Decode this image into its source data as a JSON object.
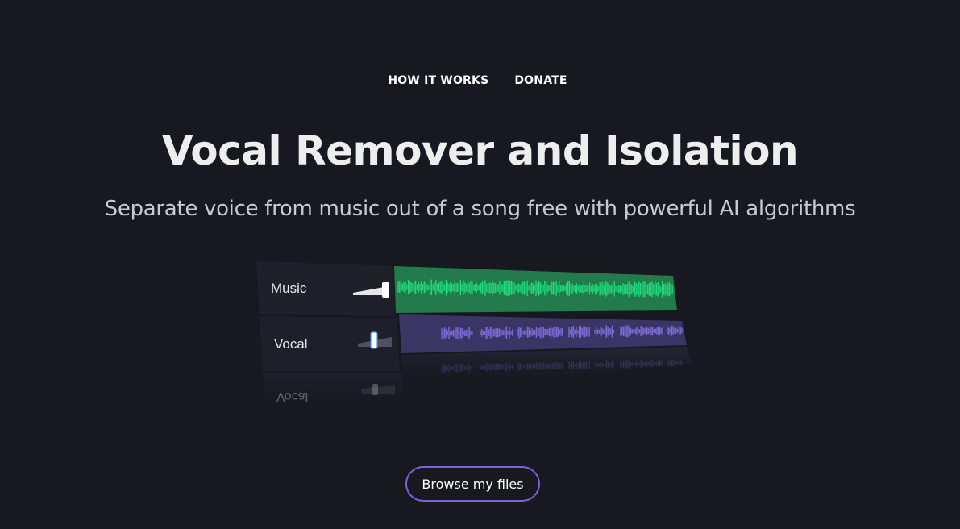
{
  "nav": {
    "items": [
      {
        "label": "HOW IT WORKS"
      },
      {
        "label": "DONATE"
      }
    ]
  },
  "hero": {
    "title": "Vocal Remover and Isolation",
    "subtitle": "Separate voice from music out of a song free with powerful AI algorithms"
  },
  "mixer": {
    "tracks": [
      {
        "label": "Music",
        "color": "#1fd67a",
        "background": "#237a4a",
        "slider_level": 1.0
      },
      {
        "label": "Vocal",
        "color": "#7c6bd3",
        "background": "#3b3566",
        "slider_level": 0.4
      }
    ],
    "reflection_label": "Vocal"
  },
  "actions": {
    "browse_label": "Browse my files"
  },
  "colors": {
    "background": "#181820",
    "accent": "#7b62d6",
    "music_wave": "#1fd67a",
    "vocal_wave": "#7c6bd3"
  }
}
